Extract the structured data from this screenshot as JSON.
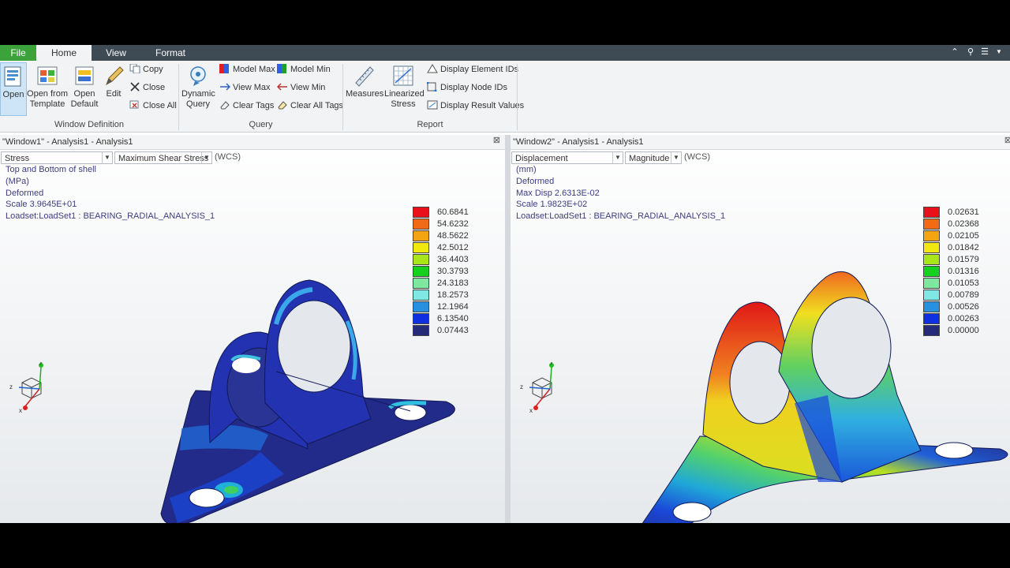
{
  "tabs": {
    "file": "File",
    "home": "Home",
    "view": "View",
    "format": "Format"
  },
  "ribbon": {
    "window_definition": {
      "label": "Window Definition",
      "open": "Open",
      "open_template_1": "Open from",
      "open_template_2": "Template",
      "open_default_1": "Open",
      "open_default_2": "Default",
      "edit": "Edit",
      "copy": "Copy",
      "close": "Close",
      "close_all": "Close All"
    },
    "query": {
      "label": "Query",
      "dynamic_query_1": "Dynamic",
      "dynamic_query_2": "Query",
      "model_max": "Model Max",
      "model_min": "Model Min",
      "view_max": "View Max",
      "view_min": "View Min",
      "clear_tags": "Clear Tags",
      "clear_all_tags": "Clear All Tags"
    },
    "report": {
      "label": "Report",
      "measures": "Measures",
      "linearized_1": "Linearized",
      "linearized_2": "Stress",
      "display_element_ids": "Display Element IDs",
      "display_node_ids": "Display Node IDs",
      "display_result_values": "Display Result Values"
    }
  },
  "window1": {
    "title": "\"Window1\" - Analysis1 - Analysis1",
    "quantity": "Stress",
    "component": "Maximum Shear Stress",
    "wcs": "(WCS)",
    "info": [
      "Top and Bottom of shell",
      "(MPa)",
      "Deformed",
      "Scale  3.9645E+01",
      "Loadset:LoadSet1 :   BEARING_RADIAL_ANALYSIS_1"
    ],
    "legend": [
      "60.6841",
      "54.6232",
      "48.5622",
      "42.5012",
      "36.4403",
      "30.3793",
      "24.3183",
      "18.2573",
      "12.1964",
      "6.13540",
      "0.07443"
    ]
  },
  "window2": {
    "title": "\"Window2\" - Analysis1 - Analysis1",
    "quantity": "Displacement",
    "component": "Magnitude",
    "wcs": "(WCS)",
    "info": [
      "(mm)",
      "Deformed",
      "Max Disp  2.6313E-02",
      "Scale  1.9823E+02",
      "Loadset:LoadSet1 :   BEARING_RADIAL_ANALYSIS_1"
    ],
    "legend": [
      "0.02631",
      "0.02368",
      "0.02105",
      "0.01842",
      "0.01579",
      "0.01316",
      "0.01053",
      "0.00789",
      "0.00526",
      "0.00263",
      "0.00000"
    ]
  },
  "legend_colors": [
    "#e8101a",
    "#f26a13",
    "#f4a313",
    "#f0e80f",
    "#a8e61a",
    "#13d11c",
    "#7ee8a0",
    "#7fe8e3",
    "#2790e0",
    "#1030e0",
    "#262a7a"
  ],
  "axes": {
    "x": "x",
    "y": "y",
    "z": "z"
  }
}
